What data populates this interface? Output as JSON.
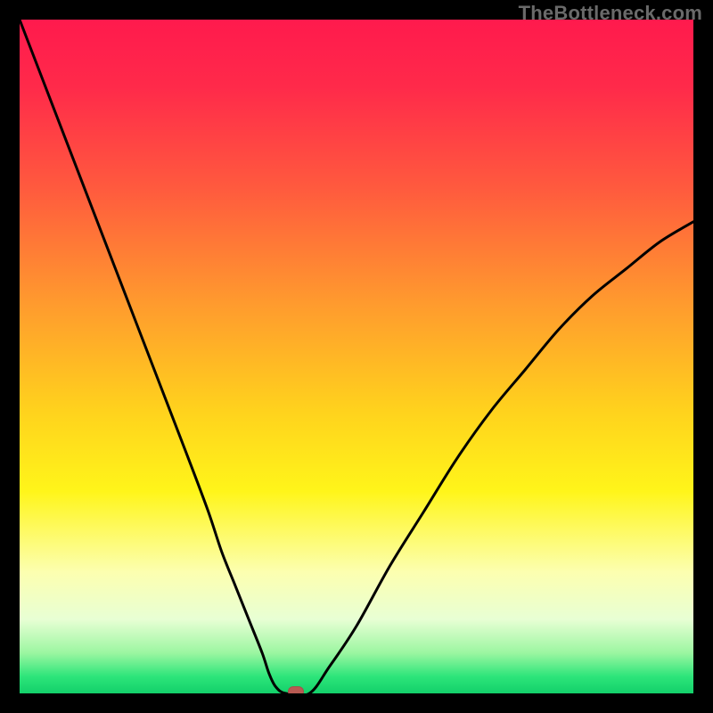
{
  "watermark": "TheBottleneck.com",
  "colors": {
    "frame": "#000000",
    "curve": "#000000",
    "marker": "#b75a52",
    "gradient_stops": [
      {
        "pos": 0.0,
        "hex": "#ff1a4d"
      },
      {
        "pos": 0.1,
        "hex": "#ff2a4a"
      },
      {
        "pos": 0.25,
        "hex": "#ff5a3e"
      },
      {
        "pos": 0.42,
        "hex": "#ff9a2e"
      },
      {
        "pos": 0.58,
        "hex": "#ffd21d"
      },
      {
        "pos": 0.7,
        "hex": "#fff51a"
      },
      {
        "pos": 0.82,
        "hex": "#fcffb0"
      },
      {
        "pos": 0.89,
        "hex": "#e8ffd4"
      },
      {
        "pos": 0.94,
        "hex": "#9bf6a1"
      },
      {
        "pos": 0.975,
        "hex": "#2de57a"
      },
      {
        "pos": 1.0,
        "hex": "#13d06a"
      }
    ]
  },
  "chart_data": {
    "type": "line",
    "title": "",
    "xlabel": "",
    "ylabel": "",
    "xlim": [
      0,
      100
    ],
    "ylim": [
      0,
      100
    ],
    "series": [
      {
        "name": "bottleneck-curve",
        "x": [
          0,
          5,
          10,
          15,
          20,
          25,
          28,
          30,
          32,
          34,
          36,
          37,
          38,
          39.5,
          43,
          46,
          50,
          55,
          60,
          65,
          70,
          75,
          80,
          85,
          90,
          95,
          100
        ],
        "y": [
          100,
          87,
          74,
          61,
          48,
          35,
          27,
          21,
          16,
          11,
          6,
          3,
          1,
          0,
          0,
          4,
          10,
          19,
          27,
          35,
          42,
          48,
          54,
          59,
          63,
          67,
          70
        ]
      }
    ],
    "flat_segment": {
      "x_start": 38,
      "x_end": 43,
      "y": 0
    },
    "marker": {
      "x": 41,
      "y": 0
    },
    "annotations": [
      {
        "text": "TheBottleneck.com",
        "role": "watermark",
        "position": "top-right"
      }
    ]
  }
}
